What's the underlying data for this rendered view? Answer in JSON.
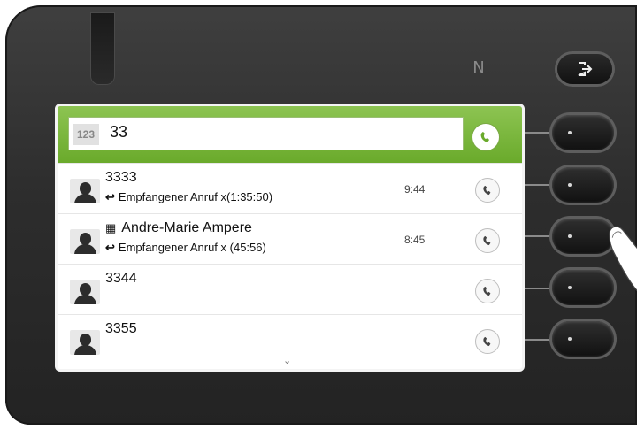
{
  "device": {
    "nfc_symbol": "N",
    "logout_icon": "logout-arrow-icon"
  },
  "input": {
    "mode_label": "123",
    "value": "33"
  },
  "list": {
    "rows": [
      {
        "name": "3333",
        "detail": "Empfangener Anruf x(1:35:50)",
        "time": "9:44",
        "has_building": false
      },
      {
        "name": "Andre-Marie Ampere",
        "detail": "Empfangener Anruf x (45:56)",
        "time": "8:45",
        "has_building": true
      },
      {
        "name": "3344",
        "detail": "",
        "time": "",
        "has_building": false
      },
      {
        "name": "3355",
        "detail": "",
        "time": "",
        "has_building": false
      }
    ],
    "scroll_hint": "⌄"
  },
  "colors": {
    "accent_green": "#6aaa2b",
    "device_dark": "#2d2d2d"
  }
}
